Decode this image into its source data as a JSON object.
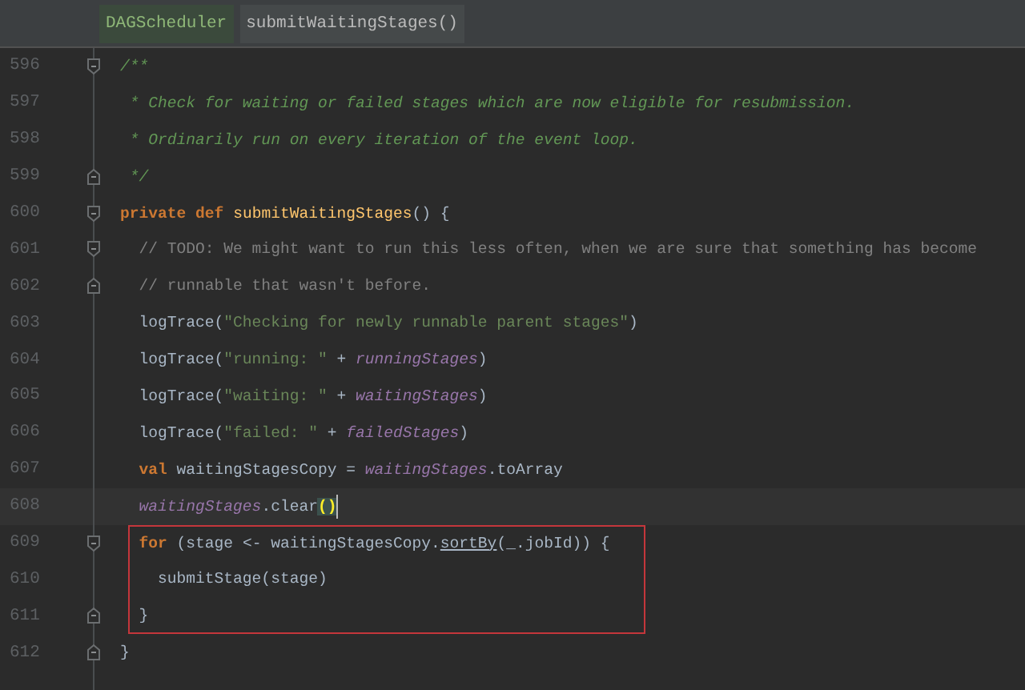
{
  "breadcrumbs": [
    {
      "label": "DAGScheduler",
      "selected": true
    },
    {
      "label": "submitWaitingStages()",
      "selected": false
    }
  ],
  "lines": [
    {
      "number": "596",
      "kind": "fold_start",
      "tokens": [
        {
          "kind": "doc",
          "text": "/**"
        }
      ]
    },
    {
      "number": "597",
      "kind": "plain",
      "tokens": [
        {
          "kind": "doc",
          "text": " * Check for waiting or failed stages which are now eligible for resubmission."
        }
      ]
    },
    {
      "number": "598",
      "kind": "plain",
      "tokens": [
        {
          "kind": "doc",
          "text": " * Ordinarily run on every iteration of the event loop."
        }
      ]
    },
    {
      "number": "599",
      "kind": "fold_end",
      "tokens": [
        {
          "kind": "doc",
          "text": " */"
        }
      ]
    },
    {
      "number": "600",
      "kind": "fold_start",
      "tokens": [
        {
          "kind": "keyword",
          "text": "private def "
        },
        {
          "kind": "method",
          "text": "submitWaitingStages"
        },
        {
          "kind": "plain",
          "text": "() {"
        }
      ]
    },
    {
      "number": "601",
      "kind": "fold_start",
      "tokens": [
        {
          "kind": "comment",
          "text": "  // TODO: We might want to run this less often, when we are sure that something has become"
        }
      ]
    },
    {
      "number": "602",
      "kind": "fold_end",
      "tokens": [
        {
          "kind": "comment",
          "text": "  // runnable that wasn't before."
        }
      ]
    },
    {
      "number": "603",
      "kind": "plain",
      "tokens": [
        {
          "kind": "plain",
          "text": "  logTrace("
        },
        {
          "kind": "string",
          "text": "\"Checking for newly runnable parent stages\""
        },
        {
          "kind": "plain",
          "text": ")"
        }
      ]
    },
    {
      "number": "604",
      "kind": "plain",
      "tokens": [
        {
          "kind": "plain",
          "text": "  logTrace("
        },
        {
          "kind": "string",
          "text": "\"running: \""
        },
        {
          "kind": "plain",
          "text": " + "
        },
        {
          "kind": "field",
          "text": "runningStages"
        },
        {
          "kind": "plain",
          "text": ")"
        }
      ]
    },
    {
      "number": "605",
      "kind": "plain",
      "tokens": [
        {
          "kind": "plain",
          "text": "  logTrace("
        },
        {
          "kind": "string",
          "text": "\"waiting: \""
        },
        {
          "kind": "plain",
          "text": " + "
        },
        {
          "kind": "field",
          "text": "waitingStages"
        },
        {
          "kind": "plain",
          "text": ")"
        }
      ]
    },
    {
      "number": "606",
      "kind": "plain",
      "tokens": [
        {
          "kind": "plain",
          "text": "  logTrace("
        },
        {
          "kind": "string",
          "text": "\"failed: \""
        },
        {
          "kind": "plain",
          "text": " + "
        },
        {
          "kind": "field",
          "text": "failedStages"
        },
        {
          "kind": "plain",
          "text": ")"
        }
      ]
    },
    {
      "number": "607",
      "kind": "plain",
      "tokens": [
        {
          "kind": "keyword",
          "text": "  val"
        },
        {
          "kind": "plain",
          "text": " waitingStagesCopy = "
        },
        {
          "kind": "field",
          "text": "waitingStages"
        },
        {
          "kind": "plain",
          "text": ".toArray"
        }
      ]
    },
    {
      "number": "608",
      "kind": "plain",
      "current": true,
      "cursor": true,
      "tokens": [
        {
          "kind": "field",
          "text": "  waitingStages"
        },
        {
          "kind": "plain",
          "text": ".clear"
        },
        {
          "kind": "brace_match",
          "text": "()"
        }
      ]
    },
    {
      "number": "609",
      "kind": "fold_start",
      "boxed": true,
      "tokens": [
        {
          "kind": "keyword",
          "text": "  for"
        },
        {
          "kind": "plain",
          "text": " (stage <- waitingStagesCopy."
        },
        {
          "kind": "underlined",
          "text": "sortBy"
        },
        {
          "kind": "plain",
          "text": "(_.jobId)) {"
        }
      ]
    },
    {
      "number": "610",
      "kind": "plain",
      "boxed": true,
      "tokens": [
        {
          "kind": "plain",
          "text": "    submitStage(stage)"
        }
      ]
    },
    {
      "number": "611",
      "kind": "fold_end",
      "boxed": true,
      "tokens": [
        {
          "kind": "plain",
          "text": "  }"
        }
      ]
    },
    {
      "number": "612",
      "kind": "fold_end",
      "tokens": [
        {
          "kind": "plain",
          "text": "}"
        }
      ]
    }
  ]
}
